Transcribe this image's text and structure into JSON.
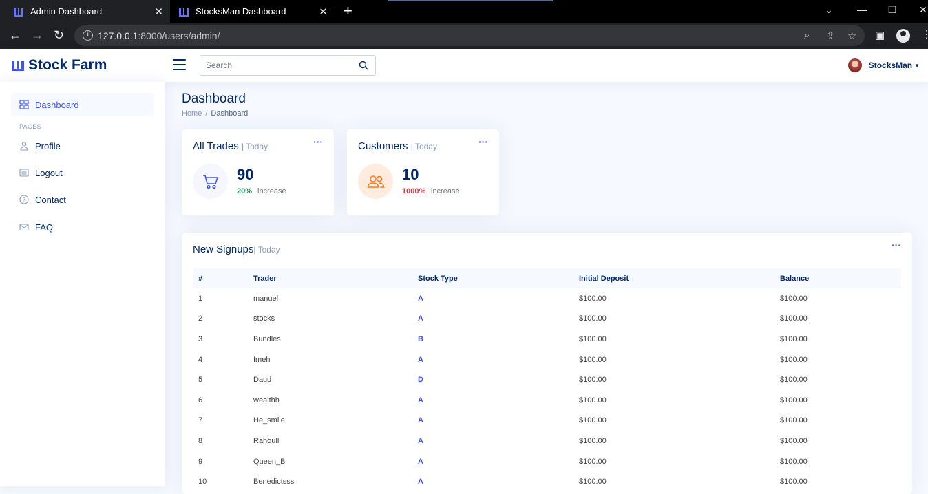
{
  "browser": {
    "tabs": [
      {
        "title": "Admin Dashboard",
        "active": true
      },
      {
        "title": "StocksMan Dashboard",
        "active": false
      }
    ],
    "url_host": "127.0.0.1",
    "url_rest": ":8000/users/admin/"
  },
  "header": {
    "brand": "Stock Farm",
    "search_placeholder": "Search",
    "user_name": "StocksMan"
  },
  "sidebar": {
    "items": [
      {
        "label": "Dashboard",
        "icon": "grid-icon",
        "active": true
      },
      {
        "label": "Profile",
        "icon": "person-icon"
      },
      {
        "label": "Logout",
        "icon": "card-list-icon"
      },
      {
        "label": "Contact",
        "icon": "question-circle-icon"
      },
      {
        "label": "FAQ",
        "icon": "envelope-icon"
      }
    ],
    "heading": "Pages"
  },
  "page": {
    "title": "Dashboard",
    "breadcrumb": [
      "Home",
      "Dashboard"
    ]
  },
  "cards": {
    "trades": {
      "title": "All Trades",
      "period": "| Today",
      "value": "90",
      "pct": "20%",
      "label": "increase",
      "pct_color": "#198754"
    },
    "customers": {
      "title": "Customers",
      "period": "| Today",
      "value": "10",
      "pct": "1000%",
      "label": "increase",
      "pct_color": "#dc3545"
    }
  },
  "signups": {
    "title": "New Signups",
    "period": "| Today",
    "columns": [
      "#",
      "Trader",
      "Stock Type",
      "Initial Deposit",
      "Balance"
    ],
    "rows": [
      [
        "1",
        "manuel",
        "A",
        "$100.00",
        "$100.00"
      ],
      [
        "2",
        "stocks",
        "A",
        "$100.00",
        "$100.00"
      ],
      [
        "3",
        "Bundles",
        "B",
        "$100.00",
        "$100.00"
      ],
      [
        "4",
        "Imeh",
        "A",
        "$100.00",
        "$100.00"
      ],
      [
        "5",
        "Daud",
        "D",
        "$100.00",
        "$100.00"
      ],
      [
        "6",
        "wealthh",
        "A",
        "$100.00",
        "$100.00"
      ],
      [
        "7",
        "He_smile",
        "A",
        "$100.00",
        "$100.00"
      ],
      [
        "8",
        "Rahoulll",
        "A",
        "$100.00",
        "$100.00"
      ],
      [
        "9",
        "Queen_B",
        "A",
        "$100.00",
        "$100.00"
      ],
      [
        "10",
        "Benedictsss",
        "A",
        "$100.00",
        "$100.00"
      ]
    ]
  },
  "colors": {
    "accent": "#4154f1",
    "navy": "#012970",
    "muted": "#899bbd"
  }
}
